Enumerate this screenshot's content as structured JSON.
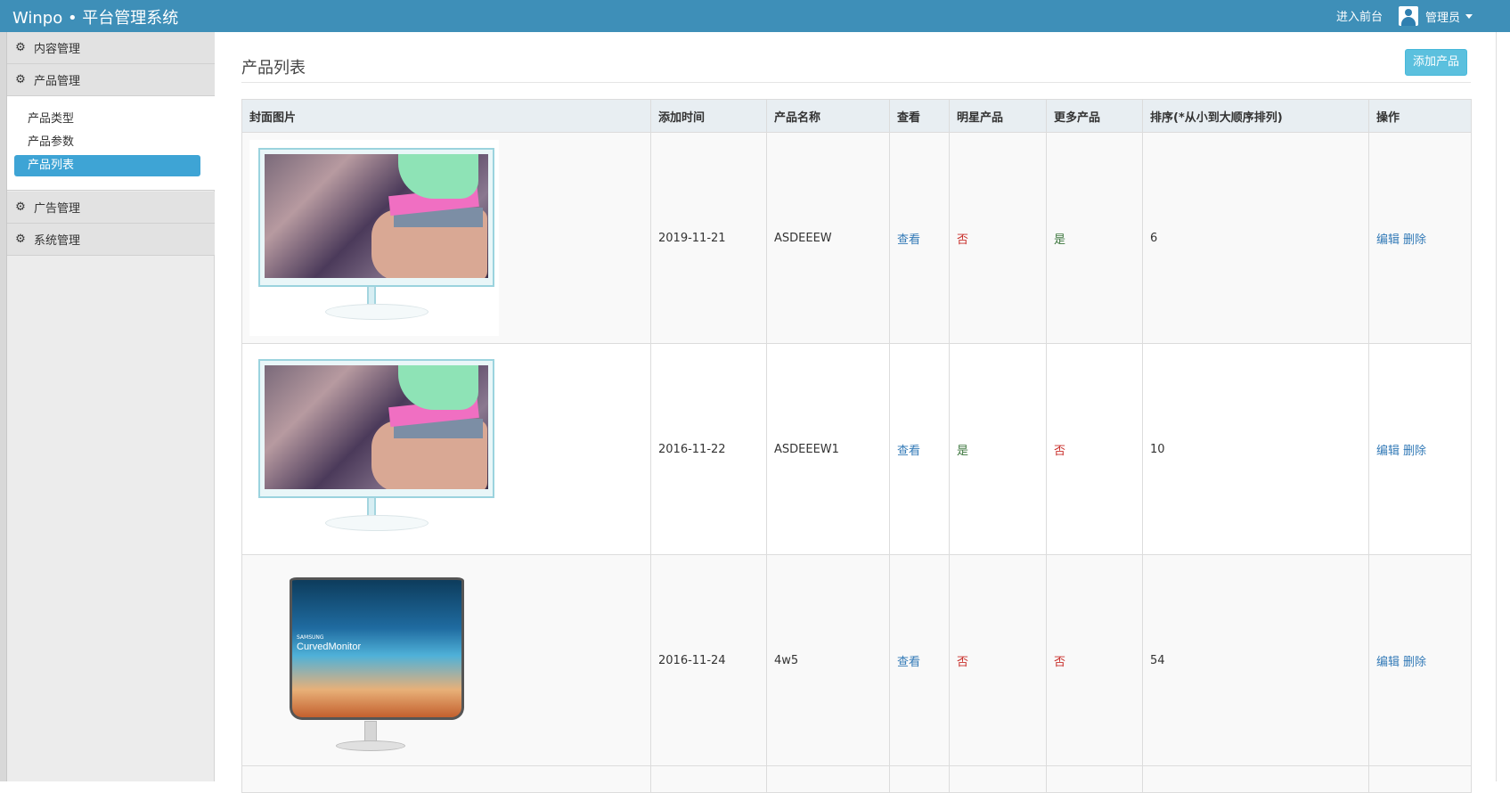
{
  "header": {
    "brand": "Winpo • 平台管理系统",
    "front_link": "进入前台",
    "user_name": "管理员"
  },
  "sidebar": {
    "groups": [
      {
        "label": "内容管理",
        "icon": "gear-icon"
      },
      {
        "label": "产品管理",
        "icon": "gear-icon"
      },
      {
        "label": "广告管理",
        "icon": "gear-icon"
      },
      {
        "label": "系统管理",
        "icon": "gear-icon"
      }
    ],
    "submenu": [
      {
        "label": "产品类型"
      },
      {
        "label": "产品参数"
      },
      {
        "label": "产品列表",
        "active": true
      }
    ]
  },
  "main": {
    "title": "产品列表",
    "add_button": "添加产品",
    "columns": [
      "封面图片",
      "添加时间",
      "产品名称",
      "查看",
      "明星产品",
      "更多产品",
      "排序(*从小到大顺序排列)",
      "操作"
    ],
    "rows": [
      {
        "cover": "monitor-lifestyle",
        "date": "2019-11-21",
        "name": "ASDEEEW",
        "view": "查看",
        "star": "否",
        "more": "是",
        "order": "6",
        "edit": "编辑",
        "delete": "删除"
      },
      {
        "cover": "monitor-lifestyle",
        "date": "2016-11-22",
        "name": "ASDEEEW1",
        "view": "查看",
        "star": "是",
        "more": "否",
        "order": "10",
        "edit": "编辑",
        "delete": "删除"
      },
      {
        "cover": "curved-monitor",
        "date": "2016-11-24",
        "name": "4w5",
        "view": "查看",
        "star": "否",
        "more": "否",
        "order": "54",
        "edit": "编辑",
        "delete": "删除",
        "cover_brand": "SAMSUNG",
        "cover_label": "CurvedMonitor"
      }
    ]
  },
  "colors": {
    "topbar": "#3e8fb8",
    "active_item": "#3ea4d5",
    "add_button": "#5bc0de",
    "link": "#337ab7",
    "no": "#c9302c",
    "yes": "#3c763d"
  }
}
